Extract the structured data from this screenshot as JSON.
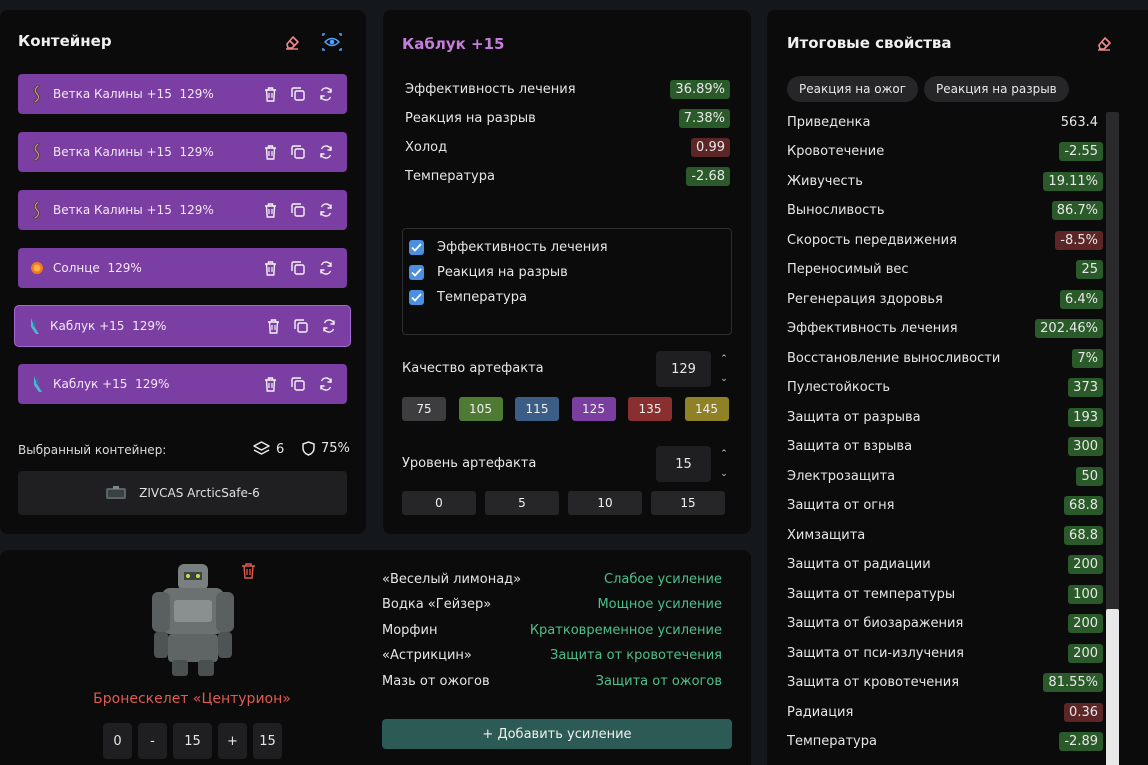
{
  "container": {
    "title": "Контейнер",
    "items": [
      {
        "label": "Ветка Калины +15",
        "quality": "129%",
        "icon": "branch-icon"
      },
      {
        "label": "Ветка Калины +15",
        "quality": "129%",
        "icon": "branch-icon"
      },
      {
        "label": "Ветка Калины +15",
        "quality": "129%",
        "icon": "branch-icon"
      },
      {
        "label": "Солнце",
        "quality": "129%",
        "icon": "sun-icon"
      },
      {
        "label": "Каблук +15",
        "quality": "129%",
        "icon": "heel-icon"
      },
      {
        "label": "Каблук +15",
        "quality": "129%",
        "icon": "heel-icon"
      }
    ],
    "selected_label": "Выбранный контейнер:",
    "slots": "6",
    "protection": "75%",
    "container_name": "ZIVCAS ArcticSafe-6"
  },
  "artifact": {
    "title": "Каблук +15",
    "stats": [
      {
        "name": "Эффективность лечения",
        "value": "36.89%",
        "tone": "green"
      },
      {
        "name": "Реакция на разрыв",
        "value": "7.38%",
        "tone": "green"
      },
      {
        "name": "Холод",
        "value": "0.99",
        "tone": "red"
      },
      {
        "name": "Температура",
        "value": "-2.68",
        "tone": "green"
      }
    ],
    "checks": [
      "Эффективность лечения",
      "Реакция на разрыв",
      "Температура"
    ],
    "quality_label": "Качество артефакта",
    "quality_value": "129",
    "quality_presets": [
      {
        "label": "75",
        "color": "#3d3d3f"
      },
      {
        "label": "105",
        "color": "#4f7a34"
      },
      {
        "label": "115",
        "color": "#3c5d86"
      },
      {
        "label": "125",
        "color": "#7a3ea0"
      },
      {
        "label": "135",
        "color": "#8a2f2f"
      },
      {
        "label": "145",
        "color": "#8f8226"
      }
    ],
    "level_label": "Уровень артефакта",
    "level_value": "15",
    "level_presets": [
      "0",
      "5",
      "10",
      "15"
    ]
  },
  "totals": {
    "title": "Итоговые свойства",
    "tags": [
      "Реакция на ожог",
      "Реакция на разрыв"
    ],
    "rows": [
      {
        "name": "Приведенка",
        "value": "563.4",
        "tone": "none"
      },
      {
        "name": "Кровотечение",
        "value": "-2.55",
        "tone": "green"
      },
      {
        "name": "Живучесть",
        "value": "19.11%",
        "tone": "green"
      },
      {
        "name": "Выносливость",
        "value": "86.7%",
        "tone": "green"
      },
      {
        "name": "Скорость передвижения",
        "value": "-8.5%",
        "tone": "red"
      },
      {
        "name": "Переносимый вес",
        "value": "25",
        "tone": "green"
      },
      {
        "name": "Регенерация здоровья",
        "value": "6.4%",
        "tone": "green"
      },
      {
        "name": "Эффективность лечения",
        "value": "202.46%",
        "tone": "green"
      },
      {
        "name": "Восстановление выносливости",
        "value": "7%",
        "tone": "green"
      },
      {
        "name": "Пулестойкость",
        "value": "373",
        "tone": "green"
      },
      {
        "name": "Защита от разрыва",
        "value": "193",
        "tone": "green"
      },
      {
        "name": "Защита от взрыва",
        "value": "300",
        "tone": "green"
      },
      {
        "name": "Электрозащита",
        "value": "50",
        "tone": "green"
      },
      {
        "name": "Защита от огня",
        "value": "68.8",
        "tone": "green"
      },
      {
        "name": "Химзащита",
        "value": "68.8",
        "tone": "green"
      },
      {
        "name": "Защита от радиации",
        "value": "200",
        "tone": "green"
      },
      {
        "name": "Защита от температуры",
        "value": "100",
        "tone": "green"
      },
      {
        "name": "Защита от биозаражения",
        "value": "200",
        "tone": "green"
      },
      {
        "name": "Защита от пси-излучения",
        "value": "200",
        "tone": "green"
      },
      {
        "name": "Защита от кровотечения",
        "value": "81.55%",
        "tone": "green"
      },
      {
        "name": "Радиация",
        "value": "0.36",
        "tone": "red"
      },
      {
        "name": "Температура",
        "value": "-2.89",
        "tone": "green"
      }
    ]
  },
  "suit": {
    "name": "Бронескелет «Центурион»",
    "min": "0",
    "minus": "-",
    "level": "15",
    "plus": "+",
    "max": "15"
  },
  "boosts": {
    "rows": [
      {
        "name": "«Веселый лимонад»",
        "effect": "Слабое усиление"
      },
      {
        "name": "Водка «Гейзер»",
        "effect": "Мощное усиление"
      },
      {
        "name": "Морфин",
        "effect": "Кратковременное усиление"
      },
      {
        "name": "«Астрикцин»",
        "effect": "Защита от кровотечения"
      },
      {
        "name": "Мазь от ожогов",
        "effect": "Защита от ожогов"
      }
    ],
    "add_label": "+ Добавить усиление"
  }
}
